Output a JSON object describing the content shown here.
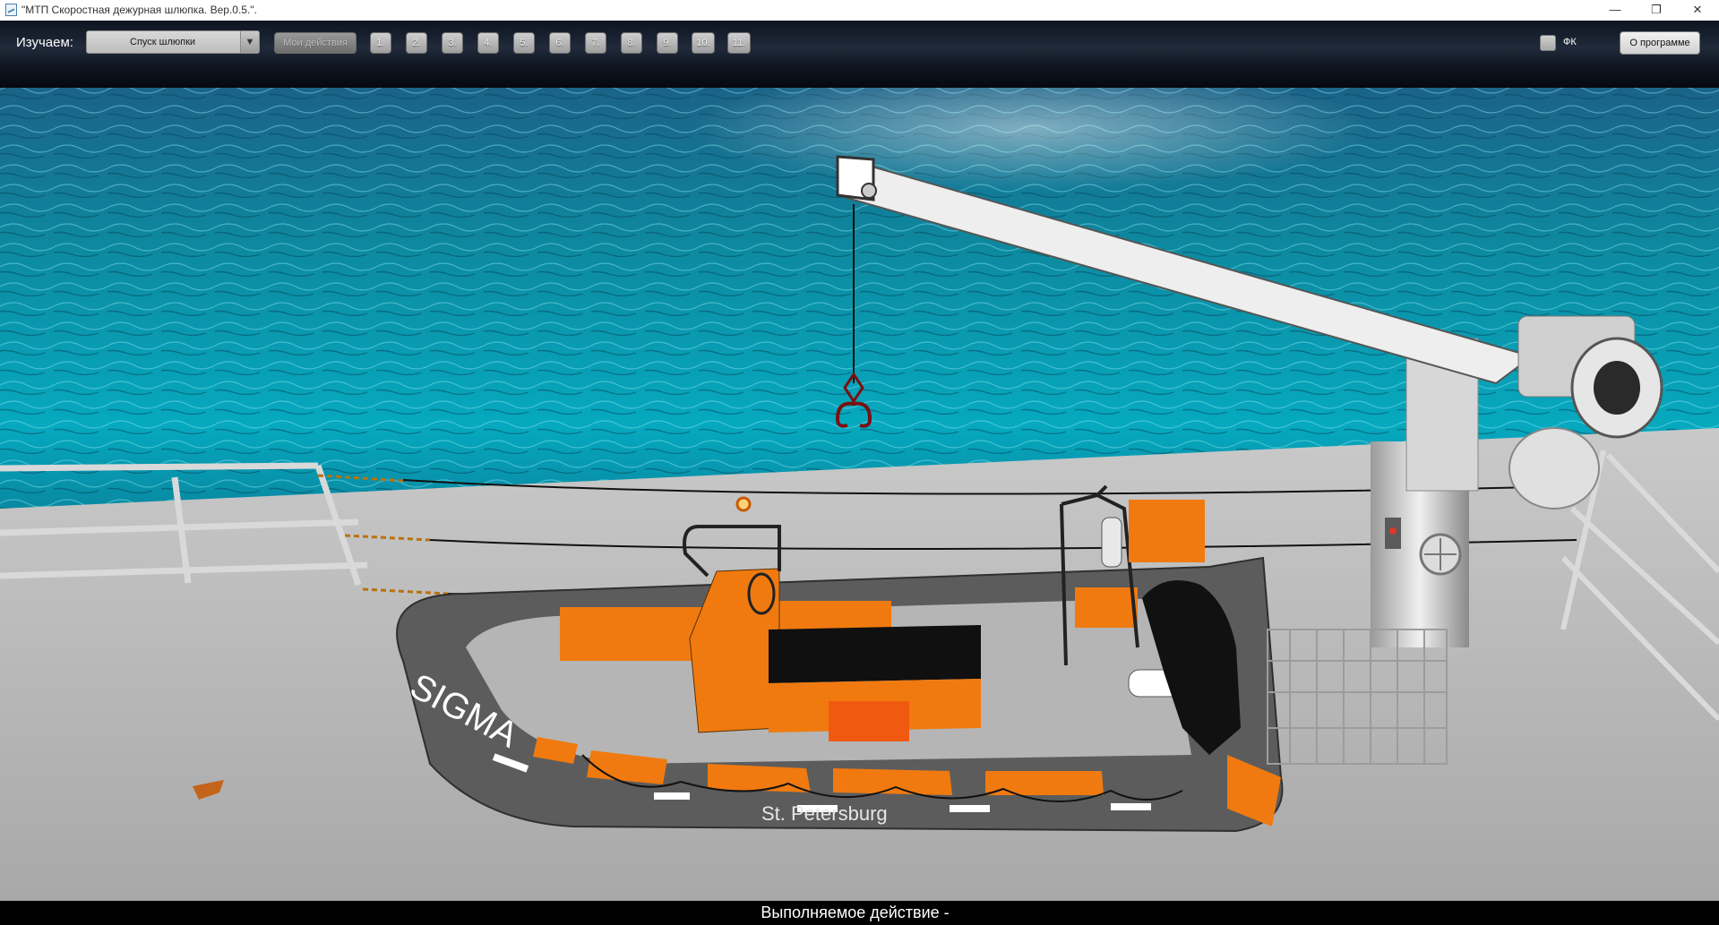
{
  "window": {
    "title": "\"МТП Скоростная дежурная шлюпка. Вер.0.5.\".",
    "icon": "app-icon",
    "controls": {
      "minimize": "—",
      "maximize": "❐",
      "close": "✕"
    }
  },
  "toolbar": {
    "study_label": "Изучаем:",
    "study_select_value": "Спуск шлюпки",
    "my_actions_label": "Мои действия",
    "step_buttons": [
      "1.",
      "2.",
      "3.",
      "4.",
      "5.",
      "6.",
      "7.",
      "8.",
      "9.",
      "10.",
      "11."
    ],
    "fk_label": "ФК",
    "fk_checked": false,
    "about_label": "О программе"
  },
  "scene": {
    "boat_brand": "SIGMA",
    "boat_home_port": "St. Petersburg",
    "colors": {
      "sea": "#0a7a8f",
      "hull_orange": "#f07a10",
      "hull_grey": "#5a5a5a",
      "deck": "#b9b9b9",
      "davit": "#e6e6e6"
    }
  },
  "status": {
    "text": "Выполняемое действие -"
  }
}
